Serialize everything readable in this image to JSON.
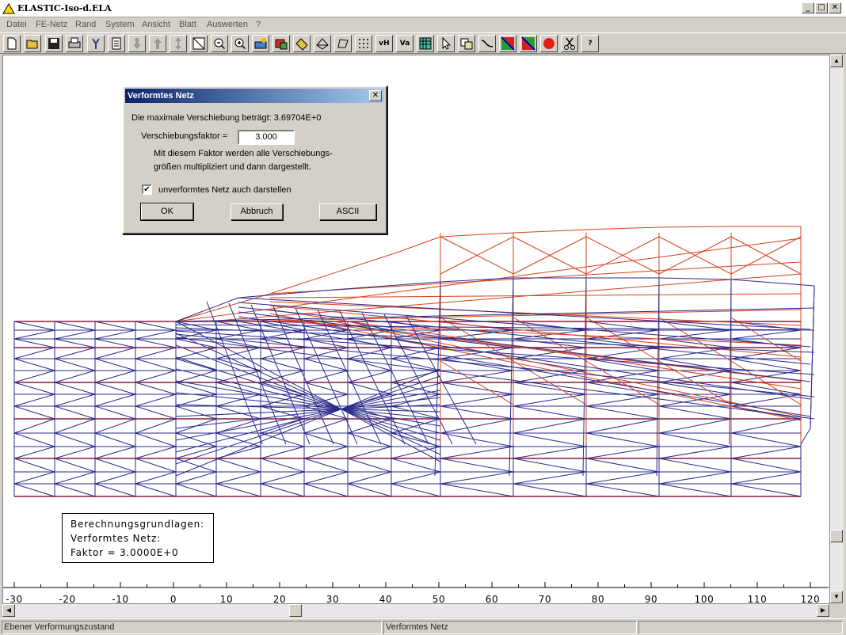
{
  "window": {
    "title": "ELASTIC-Iso-d.ELA"
  },
  "menu": [
    "Datei",
    "FE-Netz",
    "Rand",
    "System",
    "Ansicht",
    "Blatt",
    "Auswerten",
    "?"
  ],
  "toolbar": {
    "buttons": [
      "new-file-icon",
      "open-folder-icon",
      "save-icon",
      "print-icon",
      "properties-icon",
      "list-icon",
      "arrow-down-icon",
      "arrow-up-icon",
      "arrow-updown-icon",
      "zoom-window-icon",
      "zoom-out-icon",
      "zoom-in-icon",
      "view-icon",
      "node-icon",
      "element-icon",
      "mesh-icon",
      "polygon-icon",
      "points-icon",
      "vh-icon",
      "va-icon",
      "table-icon",
      "pointer-icon",
      "copy-icon",
      "line-icon",
      "color-1-icon",
      "color-2-icon",
      "record-icon",
      "scissors-icon",
      "help-icon"
    ],
    "vh_label": "vH",
    "va_label": "Va",
    "help_label": "?"
  },
  "dialog": {
    "title": "Verformtes Netz",
    "max_text": "Die maximale Verschiebung beträgt:  3.69704E+0",
    "factor_label": "Verschiebungsfaktor =",
    "factor_value": "3.000",
    "desc_line1": "Mit diesem Faktor werden alle Verschiebungs-",
    "desc_line2": "größen multipliziert und dann dargestellt.",
    "checkbox_label": "unverformtes Netz auch darstellen",
    "checkbox_checked": true,
    "check_mark": "✔",
    "ok_label": "OK",
    "cancel_label": "Abbruch",
    "ascii_label": "ASCII",
    "close_glyph": "✕"
  },
  "info_box": {
    "line1": "Berechnungsgrundlagen:",
    "line2": "Verformtes Netz:",
    "line3": "Faktor =  3.0000E+0"
  },
  "axis": {
    "ticks": [
      "-30",
      "-20",
      "-10",
      "0",
      "10",
      "20",
      "30",
      "40",
      "50",
      "60",
      "70",
      "80",
      "90",
      "100",
      "110",
      "120"
    ]
  },
  "status": {
    "left": "Ebener Verformungszustand",
    "middle": "Verformtes Netz",
    "right": ""
  },
  "colors": {
    "deformed": "#2a2a8c",
    "undeformed": "#d8401c",
    "both": "#8b1a3a"
  }
}
